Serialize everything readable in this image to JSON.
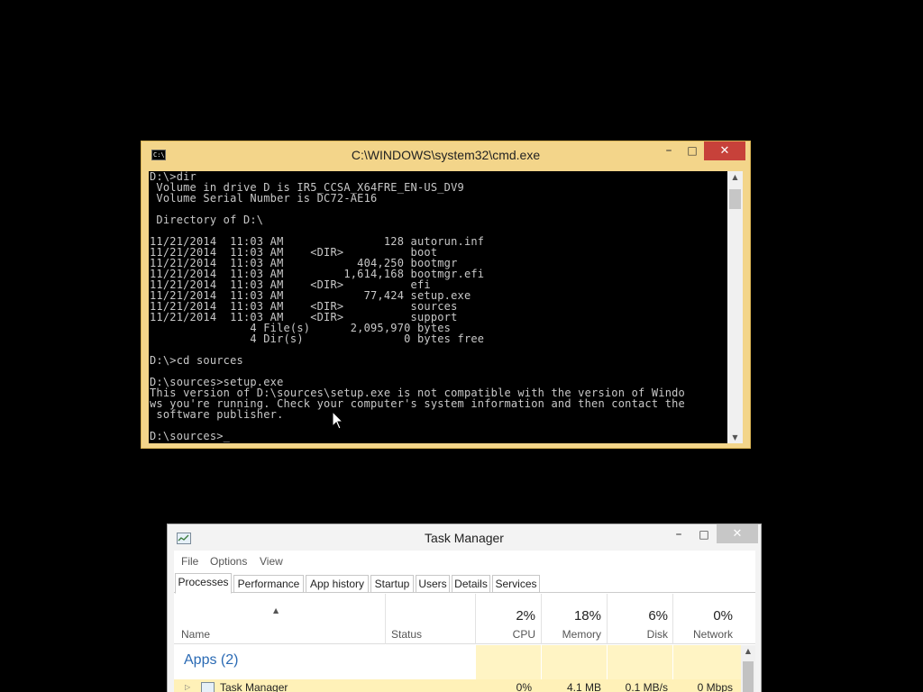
{
  "cmd": {
    "title": "C:\\WINDOWS\\system32\\cmd.exe",
    "icon_label": "C:\\",
    "minimize_icon": "minimize-icon",
    "maximize_icon": "maximize-icon",
    "close_icon": "close-icon",
    "lines": [
      "D:\\>dir",
      " Volume in drive D is IR5_CCSA_X64FRE_EN-US_DV9",
      " Volume Serial Number is DC72-AE16",
      "",
      " Directory of D:\\",
      "",
      "11/21/2014  11:03 AM               128 autorun.inf",
      "11/21/2014  11:03 AM    <DIR>          boot",
      "11/21/2014  11:03 AM           404,250 bootmgr",
      "11/21/2014  11:03 AM         1,614,168 bootmgr.efi",
      "11/21/2014  11:03 AM    <DIR>          efi",
      "11/21/2014  11:03 AM            77,424 setup.exe",
      "11/21/2014  11:03 AM    <DIR>          sources",
      "11/21/2014  11:03 AM    <DIR>          support",
      "               4 File(s)      2,095,970 bytes",
      "               4 Dir(s)               0 bytes free",
      "",
      "D:\\>cd sources",
      "",
      "D:\\sources>setup.exe",
      "This version of D:\\sources\\setup.exe is not compatible with the version of Windo",
      "ws you're running. Check your computer's system information and then contact the",
      " software publisher.",
      "",
      "D:\\sources>_"
    ]
  },
  "taskmanager": {
    "title": "Task Manager",
    "menu": [
      "File",
      "Options",
      "View"
    ],
    "tabs": [
      "Processes",
      "Performance",
      "App history",
      "Startup",
      "Users",
      "Details",
      "Services"
    ],
    "active_tab": "Processes",
    "columns": {
      "name": "Name",
      "status": "Status",
      "cpu": {
        "pct": "2%",
        "label": "CPU"
      },
      "memory": {
        "pct": "18%",
        "label": "Memory"
      },
      "disk": {
        "pct": "6%",
        "label": "Disk"
      },
      "network": {
        "pct": "0%",
        "label": "Network"
      }
    },
    "groups": [
      {
        "label": "Apps (2)",
        "rows": [
          {
            "name": "Task Manager",
            "cpu": "0%",
            "memory": "4.1 MB",
            "disk": "0.1 MB/s",
            "network": "0 Mbps"
          }
        ]
      }
    ]
  },
  "colors": {
    "cmd_frame": "#f3d58a",
    "close_button": "#c7413a",
    "console_bg": "#000000",
    "console_text": "#c8c8c8",
    "group_label": "#2a6ab4",
    "metric_highlight": "#fff4c4"
  }
}
